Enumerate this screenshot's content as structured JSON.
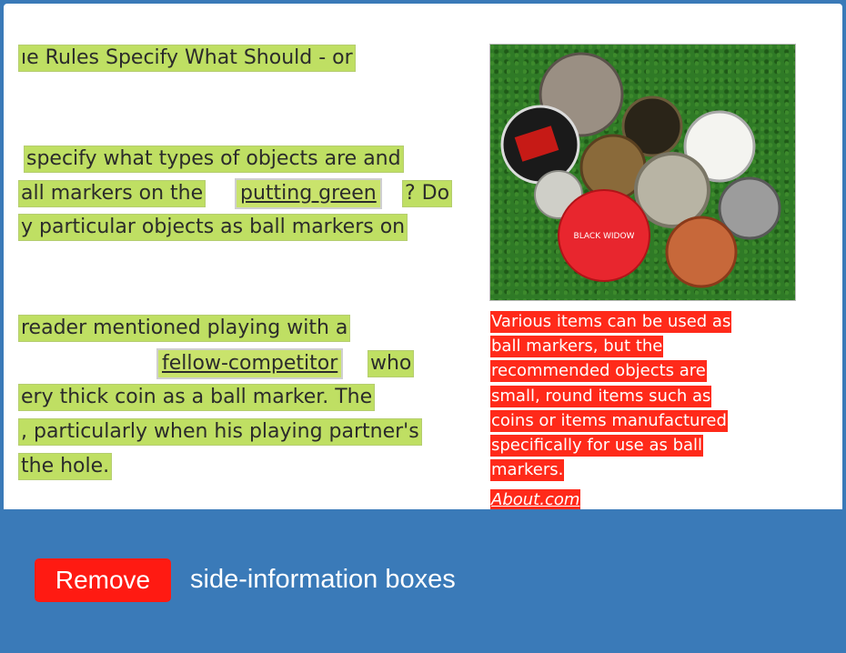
{
  "article": {
    "heading_fragment": "ıe Rules Specify What Should - or",
    "para1": {
      "line1": "specify what types of objects are and",
      "line2_before": "all markers on the",
      "link1": "putting green",
      "line2_after": "? Do",
      "line3": "y particular objects as ball markers on"
    },
    "para2": {
      "line1": "reader mentioned playing with a",
      "link2": "fellow-competitor",
      "line2_after": "who",
      "line3": "ery thick coin as a ball marker. The",
      "line4": ", particularly when his playing partner's",
      "line5": "the hole."
    }
  },
  "sidebar": {
    "image_description": "golf ball markers and coins on grass",
    "caption_lines": [
      "Various items can be used as",
      "ball markers, but the",
      "recommended objects are",
      "small, round items such as",
      "coins or items manufactured",
      "specifically for use as ball",
      "markers."
    ],
    "source": "About.com",
    "marker_text": "BLACK WIDOW"
  },
  "toolbar": {
    "button_label": "Remove",
    "label": "side-information boxes"
  },
  "colors": {
    "frame": "#3a7ab8",
    "highlight_main": "#bfdf63",
    "highlight_side": "#ff2a1a",
    "remove_button": "#ff1a12"
  }
}
